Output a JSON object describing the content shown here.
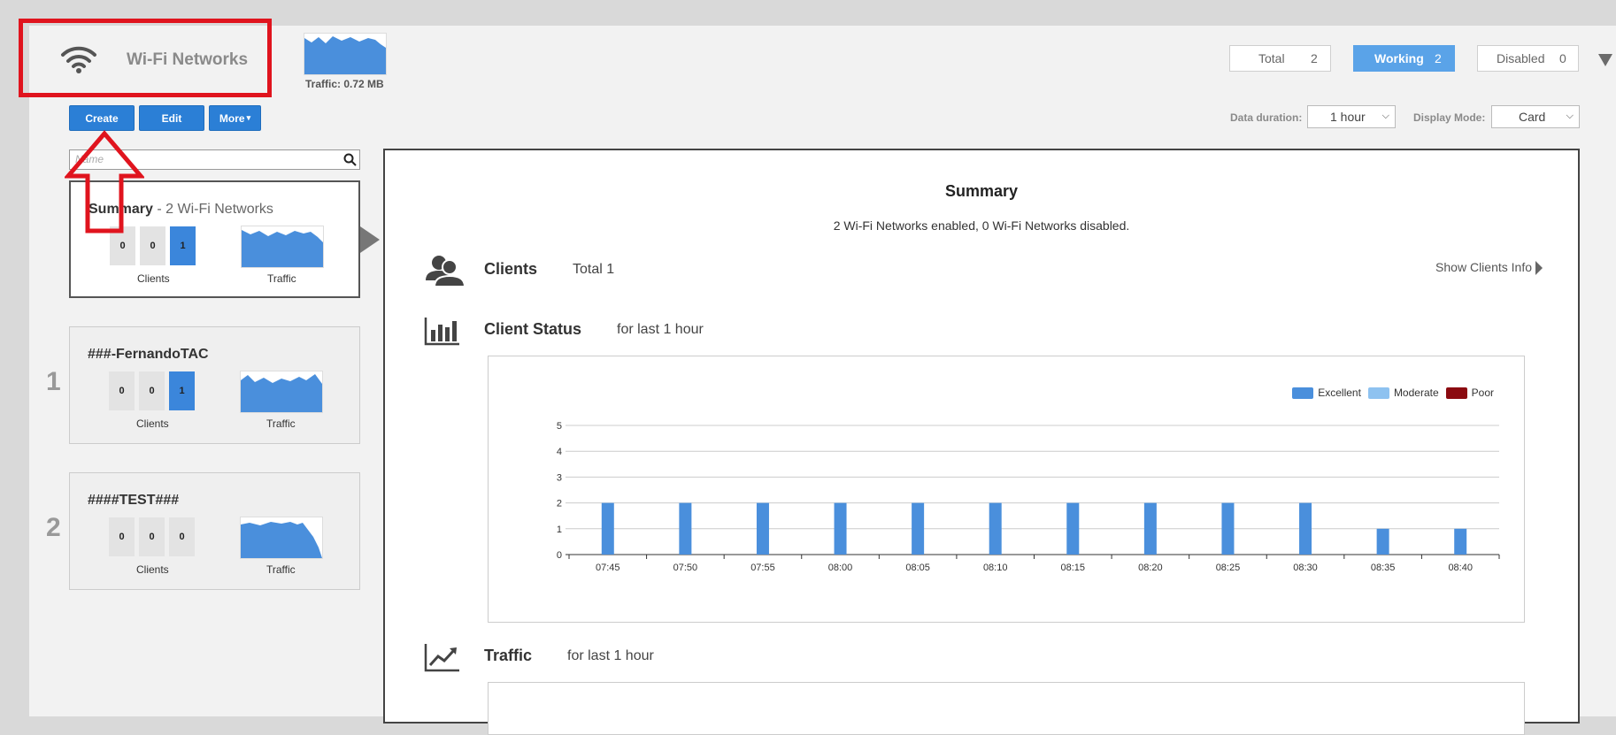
{
  "header": {
    "title": "Wi-Fi Networks",
    "traffic_caption": "Traffic: 0.72 MB",
    "stats": {
      "total_label": "Total",
      "total_value": "2",
      "working_label": "Working",
      "working_value": "2",
      "disabled_label": "Disabled",
      "disabled_value": "0"
    }
  },
  "toolbar": {
    "create_label": "Create",
    "edit_label": "Edit",
    "more_label": "More",
    "more_caret": "▾"
  },
  "controls": {
    "duration_label": "Data duration:",
    "duration_value": "1 hour",
    "display_label": "Display Mode:",
    "display_value": "Card"
  },
  "search": {
    "placeholder": "Name"
  },
  "cards": [
    {
      "title": "Summary",
      "subtitle": " - 2 Wi-Fi Networks",
      "counts": [
        "0",
        "0",
        "1"
      ],
      "clients_label": "Clients",
      "traffic_label": "Traffic"
    },
    {
      "index": "1",
      "title": "###-FernandoTAC",
      "counts": [
        "0",
        "0",
        "1"
      ],
      "clients_label": "Clients",
      "traffic_label": "Traffic"
    },
    {
      "index": "2",
      "title": "####TEST###",
      "counts": [
        "0",
        "0",
        "0"
      ],
      "clients_label": "Clients",
      "traffic_label": "Traffic"
    }
  ],
  "summary": {
    "title": "Summary",
    "description": "2 Wi-Fi Networks enabled, 0 Wi-Fi Networks disabled.",
    "clients_title": "Clients",
    "clients_total": "Total 1",
    "show_clients": "Show Clients Info",
    "client_status_title": "Client Status",
    "client_status_note": "for last 1 hour",
    "traffic_title": "Traffic",
    "traffic_note": "for last 1 hour"
  },
  "chart_data": {
    "type": "bar",
    "categories": [
      "07:45",
      "07:50",
      "07:55",
      "08:00",
      "08:05",
      "08:10",
      "08:15",
      "08:20",
      "08:25",
      "08:30",
      "08:35",
      "08:40"
    ],
    "series": [
      {
        "name": "Excellent",
        "values": [
          2,
          2,
          2,
          2,
          2,
          2,
          2,
          2,
          2,
          2,
          1,
          1
        ]
      },
      {
        "name": "Moderate",
        "values": [
          0,
          0,
          0,
          0,
          0,
          0,
          0,
          0,
          0,
          0,
          0,
          0
        ]
      },
      {
        "name": "Poor",
        "values": [
          0,
          0,
          0,
          0,
          0,
          0,
          0,
          0,
          0,
          0,
          0,
          0
        ]
      }
    ],
    "ylim": [
      0,
      5
    ],
    "yticks": [
      "0",
      "1",
      "2",
      "3",
      "4",
      "5"
    ],
    "grid": true,
    "legend_position": "top-right",
    "colors": {
      "Excellent": "#4a8fdc",
      "Moderate": "#8ec2f0",
      "Poor": "#8b0a10"
    }
  },
  "colors": {
    "accent": "#2b7fd6",
    "working": "#5aa3e8",
    "annotation": "#e0141e"
  }
}
